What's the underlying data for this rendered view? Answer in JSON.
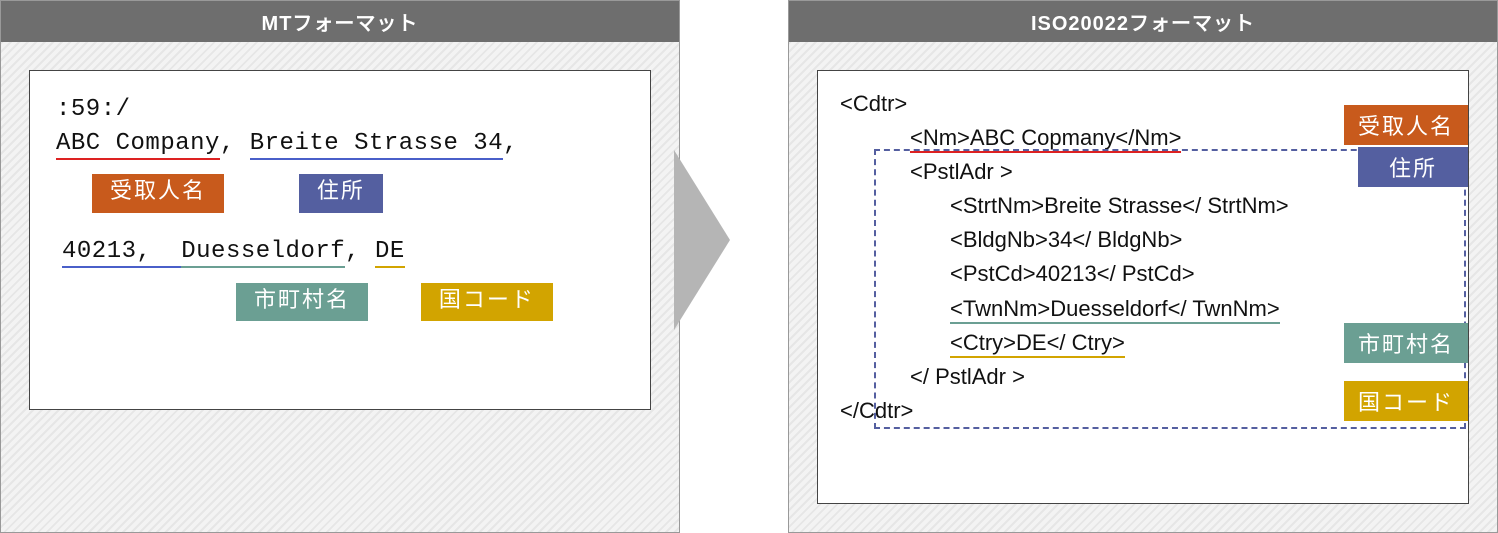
{
  "left_panel": {
    "title": "MTフォーマット",
    "line1": ":59:/",
    "company": "ABC Company",
    "street": "Breite Strasse 34",
    "post": "40213",
    "city": "Duesseldorf",
    "country": "DE",
    "tag_name": "受取人名",
    "tag_addr": "住所",
    "tag_city": "市町村名",
    "tag_ctry": "国コード"
  },
  "right_panel": {
    "title": "ISO20022フォーマット",
    "cdtr_open": "<Cdtr>",
    "nm": "<Nm>ABC Copmany</Nm>",
    "pstl_open": "<PstlAdr >",
    "strt": "<StrtNm>Breite Strasse</ StrtNm>",
    "bldg": "<BldgNb>34</ BldgNb>",
    "pstcd": "<PstCd>40213</ PstCd>",
    "twn": "<TwnNm>Duesseldorf</ TwnNm>",
    "ctry": "<Ctry>DE</ Ctry>",
    "pstl_close": "</ PstlAdr >",
    "cdtr_close": "</Cdtr>",
    "tag_name": "受取人名",
    "tag_addr": "住所",
    "tag_city": "市町村名",
    "tag_ctry": "国コード"
  }
}
